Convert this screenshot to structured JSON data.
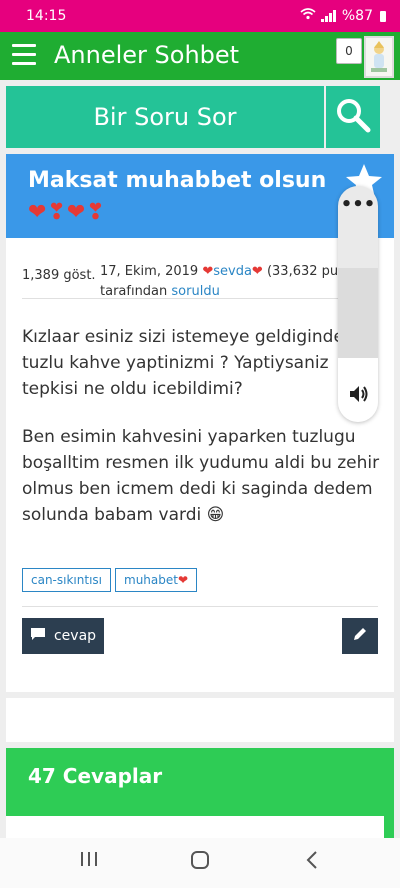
{
  "status": {
    "time": "14:15",
    "battery": "%87"
  },
  "appbar": {
    "title": "Anneler Sohbet",
    "notif_count": "0"
  },
  "ask": {
    "label": "Bir Soru Sor"
  },
  "question": {
    "title": "Maksat muhabbet olsun",
    "emoji": "❤❣❤❣",
    "views": "1,389 göst.",
    "date": "17, Ekim, 2019",
    "author": "sevda",
    "points": "(33,632 puan)",
    "by": "tarafından",
    "asked": "soruldu",
    "body1": "Kızlaar esiniz sizi istemeye geldiginde tuzlu kahve yaptinizmi ? Yaptiysaniz tepkisi ne oldu icebildimi?",
    "body2": "Ben esimin kahvesini yaparken tuzlugu boşalltim resmen ilk yudumu aldi bu zehir olmus ben icmem dedi ki saginda dedem solunda babam vardi 😁",
    "tags": [
      "can-sıkıntısı",
      "muhabet"
    ],
    "answer_label": "cevap"
  },
  "answers": {
    "heading": "47 Cevaplar"
  },
  "volume": {
    "level": 0.38
  }
}
